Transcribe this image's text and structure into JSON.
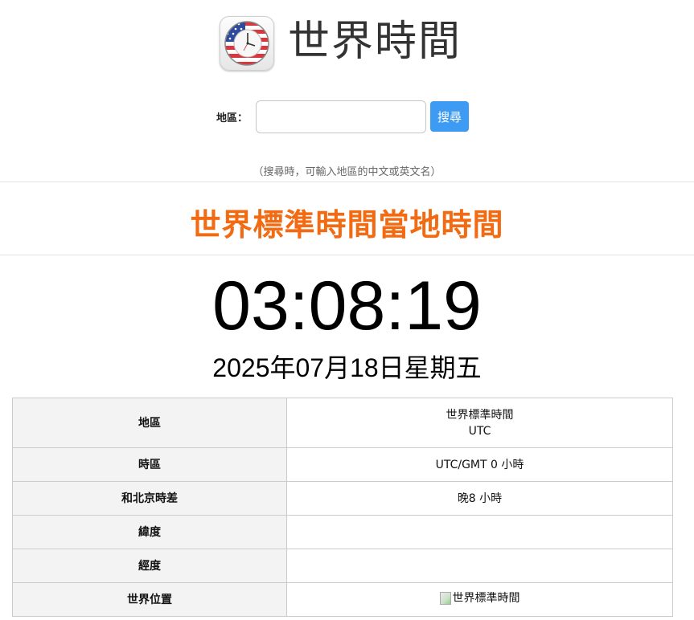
{
  "header": {
    "site_title": "世界時間",
    "logo_icon": "world-clock-flag-icon"
  },
  "search": {
    "label": "地區：",
    "input_value": "",
    "button_label": "搜尋",
    "hint": "（搜尋時，可輸入地區的中文或英文名）"
  },
  "heading": "世界標準時間當地時間",
  "clock": {
    "time": "03:08:19",
    "date": "2025年07月18日星期五"
  },
  "info_table": {
    "rows": [
      {
        "key": "地區",
        "value_line1": "世界標準時間",
        "value_line2": "UTC"
      },
      {
        "key": "時區",
        "value": "UTC/GMT 0 小時"
      },
      {
        "key": "和北京時差",
        "value": "晚8 小時"
      },
      {
        "key": "緯度",
        "value": ""
      },
      {
        "key": "經度",
        "value": ""
      },
      {
        "key": "世界位置",
        "map_alt": "世界標準時間"
      }
    ]
  },
  "colors": {
    "heading_orange": "#f26b13",
    "button_blue": "#3d9bf3",
    "table_key_bg": "#f3f3f3"
  }
}
